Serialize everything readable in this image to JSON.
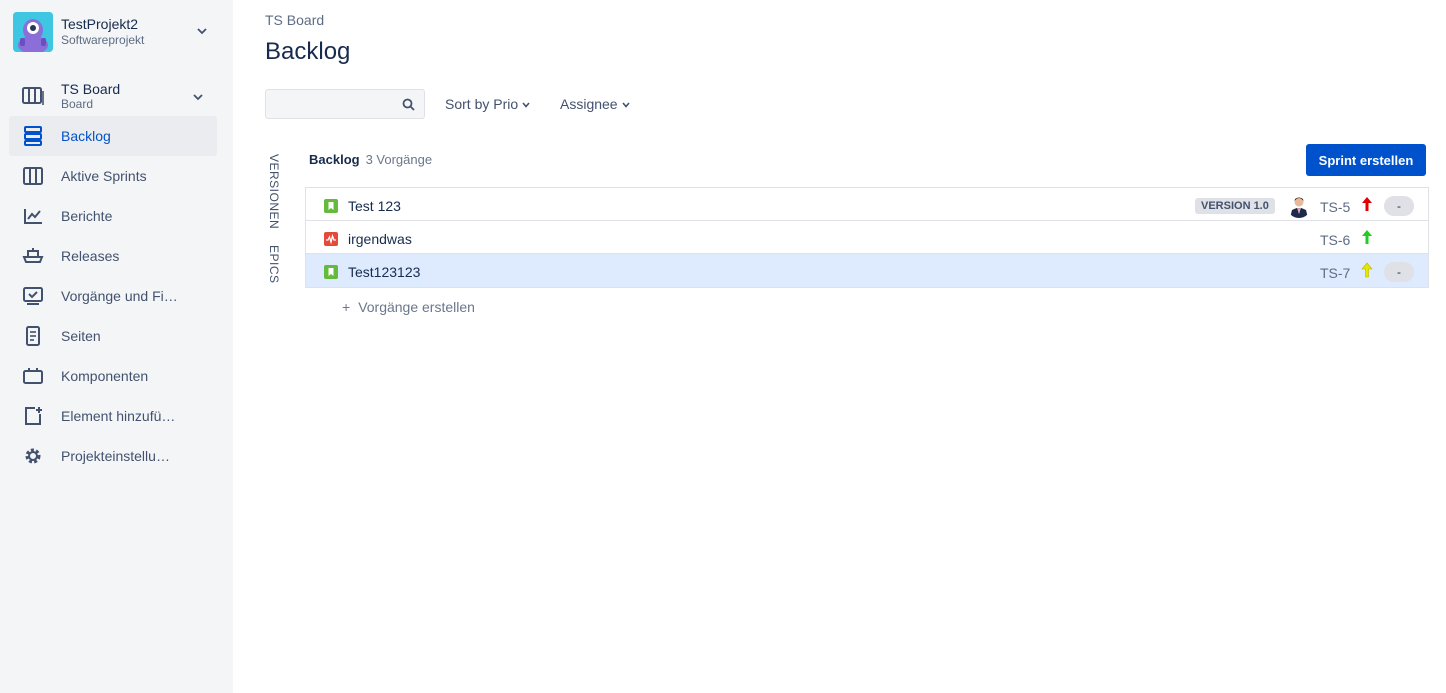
{
  "sidebar": {
    "project": {
      "name": "TestProjekt2",
      "type": "Softwareprojekt"
    },
    "board": {
      "name": "TS Board",
      "type": "Board"
    },
    "items": [
      {
        "label": "Backlog",
        "icon": "backlog-icon",
        "active": true
      },
      {
        "label": "Aktive Sprints",
        "icon": "board-columns-icon"
      },
      {
        "label": "Berichte",
        "icon": "chart-icon"
      },
      {
        "label": "Releases",
        "icon": "ship-icon"
      },
      {
        "label": "Vorgänge und Fi…",
        "icon": "issues-filters-icon"
      },
      {
        "label": "Seiten",
        "icon": "page-icon"
      },
      {
        "label": "Komponenten",
        "icon": "component-icon"
      },
      {
        "label": "Element hinzufü…",
        "icon": "add-item-icon"
      },
      {
        "label": "Projekteinstellu…",
        "icon": "gear-icon"
      }
    ]
  },
  "header": {
    "breadcrumb": "TS Board",
    "title": "Backlog"
  },
  "toolbar": {
    "search_value": "",
    "sort_label": "Sort by Prio",
    "assignee_label": "Assignee"
  },
  "vertical_tabs": {
    "versions": "VERSIONEN",
    "epics": "EPICS"
  },
  "backlog": {
    "title": "Backlog",
    "count": "3 Vorgänge",
    "sprint_button": "Sprint erstellen",
    "issues": [
      {
        "summary": "Test 123",
        "type": "story",
        "version": "VERSION 1.0",
        "has_assignee": true,
        "key": "TS-5",
        "priority": "highest",
        "priority_color": "#e00000",
        "estimate": "-"
      },
      {
        "summary": "irgendwas",
        "type": "bug",
        "version": "",
        "has_assignee": false,
        "key": "TS-6",
        "priority": "low",
        "priority_color": "#22cc22",
        "estimate": ""
      },
      {
        "summary": "Test123123",
        "type": "story",
        "version": "",
        "has_assignee": false,
        "key": "TS-7",
        "priority": "medium",
        "priority_color": "#e6e600",
        "estimate": "-",
        "selected": true
      }
    ],
    "create_label": "Vorgänge erstellen"
  },
  "colors": {
    "accent": "#0052cc",
    "story": "#63ba3c",
    "bug": "#e5493a",
    "selected_row": "#deebff"
  }
}
